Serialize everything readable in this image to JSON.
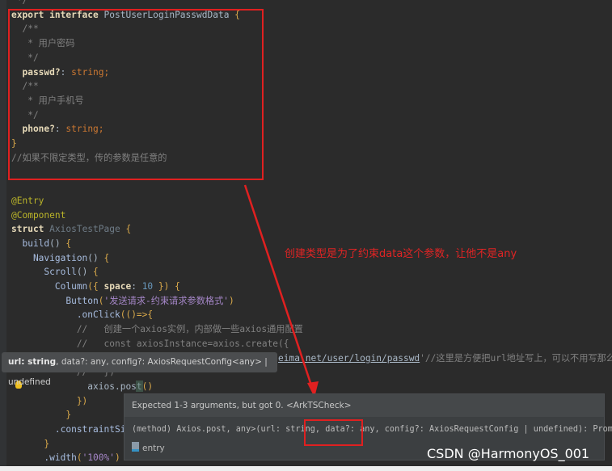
{
  "code_lines": [
    [
      {
        "t": " */",
        "c": "cm"
      }
    ],
    [
      {
        "t": "export interface ",
        "c": "kw"
      },
      {
        "t": "PostUserLoginPasswdData ",
        "c": "ty"
      },
      {
        "t": "{",
        "c": "br"
      }
    ],
    [
      {
        "t": "  /**",
        "c": "cm"
      }
    ],
    [
      {
        "t": "   * 用户密码",
        "c": "cm"
      }
    ],
    [
      {
        "t": "   */",
        "c": "cm"
      }
    ],
    [
      {
        "t": "  passwd?",
        "c": "kw"
      },
      {
        "t": ": ",
        "c": "pl"
      },
      {
        "t": "string",
        "c": "or"
      },
      {
        "t": ";",
        "c": "or"
      }
    ],
    [
      {
        "t": "  /**",
        "c": "cm"
      }
    ],
    [
      {
        "t": "   * 用户手机号",
        "c": "cm"
      }
    ],
    [
      {
        "t": "   */",
        "c": "cm"
      }
    ],
    [
      {
        "t": "  phone?",
        "c": "kw"
      },
      {
        "t": ": ",
        "c": "pl"
      },
      {
        "t": "string",
        "c": "or"
      },
      {
        "t": ";",
        "c": "or"
      }
    ],
    [
      {
        "t": "}",
        "c": "br"
      }
    ],
    [
      {
        "t": "//如果不限定类型，传的参数是任意的",
        "c": "cm"
      }
    ],
    [],
    [],
    [
      {
        "t": "@Entry",
        "c": "dec"
      }
    ],
    [
      {
        "t": "@Component",
        "c": "dec"
      }
    ],
    [
      {
        "t": "struct ",
        "c": "kw"
      },
      {
        "t": "AxiosTestPage ",
        "c": "tyd"
      },
      {
        "t": "{",
        "c": "br"
      }
    ],
    [
      {
        "t": "  build",
        "c": "fn"
      },
      {
        "t": "() ",
        "c": "pl"
      },
      {
        "t": "{",
        "c": "br"
      }
    ],
    [
      {
        "t": "    Navigation",
        "c": "fn"
      },
      {
        "t": "() ",
        "c": "pl"
      },
      {
        "t": "{",
        "c": "br"
      }
    ],
    [
      {
        "t": "      Scroll",
        "c": "fn"
      },
      {
        "t": "() ",
        "c": "pl"
      },
      {
        "t": "{",
        "c": "br"
      }
    ],
    [
      {
        "t": "        Column",
        "c": "fn"
      },
      {
        "t": "({ ",
        "c": "br"
      },
      {
        "t": "space",
        "c": "kw"
      },
      {
        "t": ": ",
        "c": "pl"
      },
      {
        "t": "10",
        "c": "nu"
      },
      {
        "t": " }) {",
        "c": "br"
      }
    ],
    [
      {
        "t": "          Button",
        "c": "fn"
      },
      {
        "t": "(",
        "c": "br"
      },
      {
        "t": "'发送请求-约束请求参数格式'",
        "c": "st"
      },
      {
        "t": ")",
        "c": "br"
      }
    ],
    [
      {
        "t": "            .onClick",
        "c": "fn"
      },
      {
        "t": "(()=>{",
        "c": "br"
      }
    ],
    [
      {
        "t": "            //   创建一个axios实例，内部做一些axios通用配置",
        "c": "cm"
      }
    ],
    [
      {
        "t": "            //   const axiosInstance=axios.create({",
        "c": "cm"
      }
    ],
    [
      {
        "t": "                                                 ",
        "c": "pl"
      },
      {
        "t": "eima.net/user/login/passwd",
        "c": "ul"
      },
      {
        "t": "'//这里是方便把url地址写上，可以不用写那么多次",
        "c": "cm"
      }
    ],
    [
      {
        "t": "            //   })",
        "c": "cm"
      }
    ],
    [
      {
        "t": "              axios.post",
        "c": "pl"
      },
      {
        "t": "()",
        "c": "br"
      }
    ],
    [
      {
        "t": "            })",
        "c": "br"
      }
    ],
    [
      {
        "t": "          }",
        "c": "br"
      }
    ],
    [
      {
        "t": "        .constraintSiz",
        "c": "fn"
      }
    ],
    [
      {
        "t": "      }",
        "c": "br"
      }
    ],
    [
      {
        "t": "      .width",
        "c": "fn"
      },
      {
        "t": "(",
        "c": "br"
      },
      {
        "t": "'100%'",
        "c": "st"
      },
      {
        "t": ")",
        "c": "br"
      }
    ]
  ],
  "annotation": "创建类型是为了约束data这个参数，让他不是any",
  "param_hint": {
    "current": "url: string",
    "rest": ", data?: any, config?: AxiosRequestConfig<any> | undefined"
  },
  "popup": {
    "error": "Expected 1-3 arguments, but got 0. <ArkTSCheck>",
    "signature": "(method) Axios.post, any>(url: string, data?: any, config?: AxiosRequestConfig | undefined): Promise>",
    "module": "entry"
  },
  "watermark": "CSDN @HarmonyOS_001",
  "colors": {
    "annotation_red": "#e02020",
    "editor_bg": "#2b2b2b"
  }
}
